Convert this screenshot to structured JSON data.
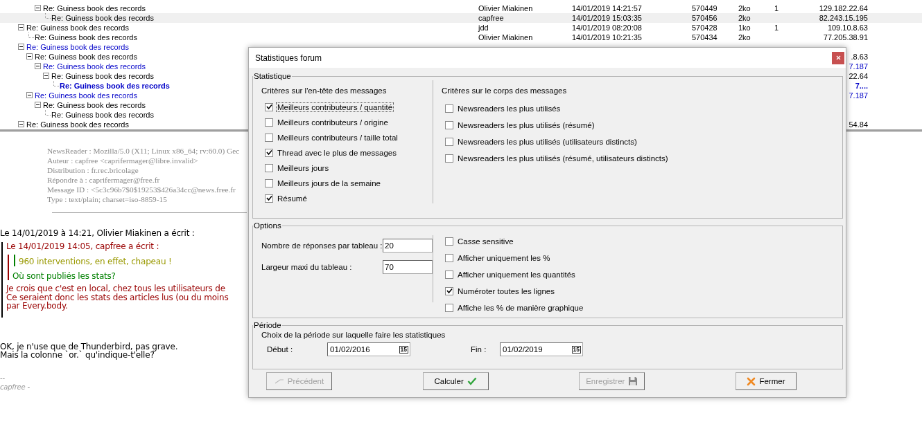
{
  "thread_list": {
    "threads": [
      {
        "children": [
          {
            "children": [
              {
                "kind": "branch",
                "subject": "Re: Guiness book des records",
                "author": "Olivier Miakinen",
                "date": "14/01/2019 14:21:57",
                "number": "570449",
                "size": "2ko",
                "replies": "1",
                "ip": "129.182.22.64",
                "unread": false,
                "open": false,
                "selected": false,
                "children": [
                  {
                    "kind": "leaf",
                    "subject": "Re: Guiness book des records",
                    "author": "capfree",
                    "date": "14/01/2019 15:03:35",
                    "number": "570456",
                    "size": "2ko",
                    "ip": "82.243.15.195",
                    "unread": false,
                    "open": false,
                    "selected": true
                  }
                ]
              }
            ]
          }
        ]
      },
      {
        "kind": "branch",
        "subject": "Re: Guiness book des records",
        "author": "jdd",
        "date": "14/01/2019 08:20:08",
        "number": "570428",
        "size": "1ko",
        "replies": "1",
        "ip": "109.10.8.63",
        "unread": false,
        "open": false,
        "selected": false,
        "children": [
          {
            "kind": "leaf",
            "subject": "Re: Guiness book des records",
            "author": "Olivier Miakinen",
            "date": "14/01/2019 10:21:35",
            "number": "570434",
            "size": "2ko",
            "ip": "77.205.38.91",
            "unread": false,
            "open": false,
            "selected": false
          }
        ]
      },
      {
        "kind": "branch",
        "subject": "Re: Guiness book des records",
        "unread": true,
        "open": false,
        "selected": false,
        "children": [
          {
            "kind": "branch",
            "subject": "Re: Guiness book des records",
            "ip": ".8.63",
            "unread": false,
            "open": false,
            "selected": false,
            "children": [
              {
                "kind": "branch",
                "subject": "Re: Guiness book des records",
                "ip": "7.187",
                "unread": true,
                "open": false,
                "selected": false,
                "children": [
                  {
                    "kind": "branch",
                    "subject": "Re: Guiness book des records",
                    "ip": "22.64",
                    "unread": false,
                    "open": false,
                    "selected": false,
                    "children": [
                      {
                        "kind": "leaf",
                        "subject": "Re: Guiness book des records",
                        "ip": "7....",
                        "unread": true,
                        "open": true,
                        "selected": false
                      }
                    ]
                  }
                ]
              }
            ]
          },
          {
            "kind": "branch",
            "subject": "Re: Guiness book des records",
            "ip": "7.187",
            "unread": true,
            "open": false,
            "selected": false,
            "children": [
              {
                "kind": "branch",
                "subject": "Re: Guiness book des records",
                "unread": false,
                "open": false,
                "selected": false,
                "children": [
                  {
                    "kind": "leaf",
                    "subject": "Re: Guiness book des records",
                    "unread": false,
                    "open": false,
                    "selected": false
                  }
                ]
              }
            ]
          }
        ]
      },
      {
        "kind": "branch",
        "subject": "Re: Guiness book des records",
        "ip": "54.84",
        "unread": false,
        "open": false,
        "selected": false
      }
    ]
  },
  "message": {
    "headers": [
      "NewsReader : Mozilla/5.0 (X11; Linux x86_64; rv:60.0) Gec",
      "Auteur : capfree <caprifermager@libre.invalid>",
      "Distribution : fr.rec.bricolage",
      "Répondre à : caprifermager@free.fr",
      "Message ID : <5c3c96b7$0$19253$426a34cc@news.free.fr",
      "Type : text/plain; charset=iso-8859-15"
    ],
    "body": [
      {
        "kind": "text",
        "lines": [
          "Le 14/01/2019 à 14:21, Olivier Miakinen a écrit :"
        ]
      },
      {
        "kind": "quote",
        "children": [
          {
            "kind": "text",
            "lines": [
              "Le 14/01/2019 14:05, capfree a écrit :"
            ]
          },
          {
            "kind": "quote",
            "children": [
              {
                "kind": "quote",
                "children": [
                  {
                    "kind": "text",
                    "lines": [
                      "960 interventions, en effet, chapeau !"
                    ]
                  }
                ]
              },
              {
                "kind": "text",
                "lines": [
                  "Où sont publiés les stats?"
                ]
              }
            ]
          },
          {
            "kind": "text",
            "lines": [
              "Je crois que c'est en local, chez tous les utilisateurs de",
              "Ce seraient donc les stats des articles lus (ou du moins",
              "par Every.body."
            ]
          }
        ]
      },
      {
        "kind": "text",
        "lines": [
          "OK, je n'use que de Thunderbird, pas grave.",
          "Mais la colonne `or.` qu'indique-t'elle?"
        ]
      },
      {
        "kind": "signature",
        "lines": [
          "--",
          "capfree -"
        ]
      }
    ]
  },
  "dialog": {
    "title": "Statistiques forum",
    "statistique": {
      "legend": "Statistique",
      "header_criteria": {
        "title": "Critères sur l'en-tête des messages",
        "items": [
          {
            "label": "Meilleurs contributeurs / quantité",
            "checked": true,
            "focused": true
          },
          {
            "label": "Meilleurs contributeurs / origine",
            "checked": false,
            "focused": false
          },
          {
            "label": "Meilleurs contributeurs / taille total",
            "checked": false,
            "focused": false
          },
          {
            "label": "Thread avec le plus de messages",
            "checked": true,
            "focused": false
          },
          {
            "label": "Meilleurs jours",
            "checked": false,
            "focused": false
          },
          {
            "label": "Meilleurs jours de la semaine",
            "checked": false,
            "focused": false
          },
          {
            "label": "Résumé",
            "checked": true,
            "focused": false
          }
        ]
      },
      "body_criteria": {
        "title": "Critères sur le corps des messages",
        "items": [
          {
            "label": "Newsreaders les plus utilisés",
            "checked": false,
            "focused": false
          },
          {
            "label": "Newsreaders les plus utilisés (résumé)",
            "checked": false,
            "focused": false
          },
          {
            "label": "Newsreaders les plus utilisés (utilisateurs distincts)",
            "checked": false,
            "focused": false
          },
          {
            "label": "Newsreaders les plus utilisés (résumé, utilisateurs distincts)",
            "checked": false,
            "focused": false
          }
        ]
      }
    },
    "options": {
      "legend": "Options",
      "fields": [
        {
          "label": "Nombre de réponses par tableau :",
          "value": "20"
        },
        {
          "label": "Largeur maxi du tableau :",
          "value": "70"
        }
      ],
      "items": [
        {
          "label": "Casse sensitive",
          "checked": false,
          "focused": false
        },
        {
          "label": "Afficher uniquement les %",
          "checked": false,
          "focused": false
        },
        {
          "label": "Afficher uniquement les quantités",
          "checked": false,
          "focused": false
        },
        {
          "label": "Numéroter toutes les lignes",
          "checked": true,
          "focused": false
        },
        {
          "label": "Affiche les % de manière graphique",
          "checked": false,
          "focused": false
        }
      ]
    },
    "periode": {
      "legend": "Période",
      "text": "Choix de la période sur laquelle faire les statistiques",
      "dates": [
        {
          "label": "Début :",
          "value": "01/02/2016",
          "icon_label": "15"
        },
        {
          "label": "Fin :",
          "value": "01/02/2019",
          "icon_label": "15"
        }
      ]
    },
    "buttons": [
      {
        "label": "Précédent",
        "disabled": true
      },
      {
        "label": "Calculer",
        "disabled": false
      },
      {
        "label": "Enregistrer",
        "disabled": true
      },
      {
        "label": "Fermer",
        "disabled": false
      }
    ]
  }
}
